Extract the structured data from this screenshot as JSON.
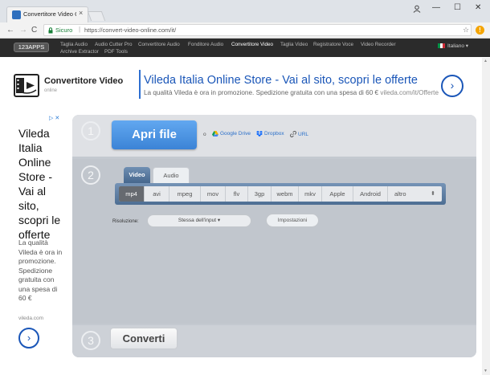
{
  "browser": {
    "tab_title": "Convertitore Video Onli",
    "tab_close": "×",
    "minimize": "—",
    "maximize": "☐",
    "close": "✕",
    "back": "←",
    "forward": "→",
    "reload": "C",
    "secure_label": "Sicuro",
    "url_separator": "|",
    "url": "https://convert-video-online.com/it/",
    "star": "☆",
    "extension_badge": "!",
    "colors": {
      "secure": "#188038",
      "accent": "#2d6fd1"
    }
  },
  "site_nav": {
    "logo": "123APPS",
    "links": [
      "Taglia Audio",
      "Audio Cutter Pro",
      "Convertitore Audio",
      "Fonditore Audio",
      "Convertitore Video",
      "Taglia Video",
      "Registratore Voce",
      "Video Recorder",
      "Archive Extractor",
      "PDF Tools"
    ],
    "active": "Convertitore Video",
    "language": "Italiano ▾"
  },
  "header": {
    "title": "Convertitore Video",
    "subtitle": "online"
  },
  "ad_top": {
    "title": "Vileda Italia Online Store - Vai al sito, scopri le offerte",
    "desc_text": "La qualità Vileda è ora in promozione. Spedizione gratuita con una spesa di 60 € ",
    "domain": "vileda.com/it/Offerte",
    "arrow": "›"
  },
  "ad_left": {
    "adchoices": "▷ ✕",
    "title": "Vileda Italia Online Store - Vai al sito, scopri le offerte",
    "desc": "La qualità Vileda è ora in promozione. Spedizione gratuita con una spesa di 60 €",
    "domain": "vileda.com",
    "arrow": "›"
  },
  "converter": {
    "step1_num": "1",
    "step2_num": "2",
    "step3_num": "3",
    "open_button": "Apri file",
    "or_text": "o",
    "sources": [
      "Google Drive",
      "Dropbox",
      "URL"
    ],
    "tabs": [
      "Video",
      "Audio"
    ],
    "active_tab": "Video",
    "formats": [
      "mp4",
      "avi",
      "mpeg",
      "mov",
      "flv",
      "3gp",
      "webm",
      "mkv",
      "Apple",
      "Android",
      "altro"
    ],
    "selected_format": "mp4",
    "more_arrow": "⬍",
    "resolution_label": "Risoluzione:",
    "resolution_value": "Stessa dell'input ▾",
    "settings_button": "Impostazioni",
    "convert_button": "Converti"
  },
  "scrollbar": {
    "up": "▲",
    "down": "▼"
  }
}
